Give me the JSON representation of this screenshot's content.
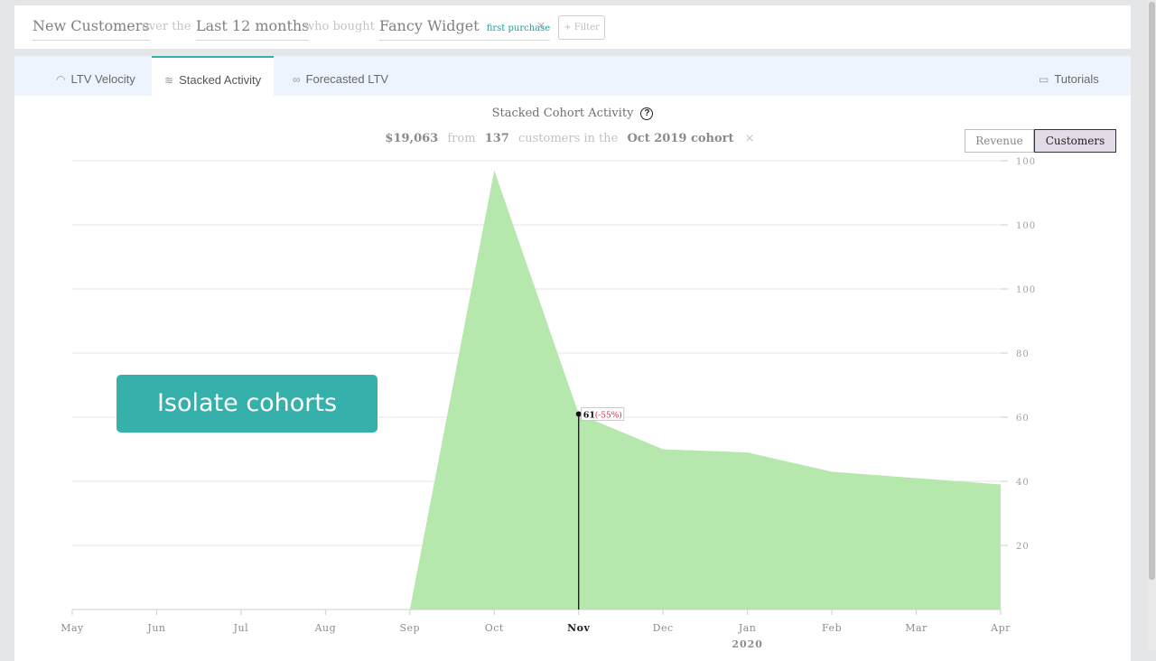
{
  "filter_bar": {
    "segment": "New Customers",
    "over_text": "over the",
    "period": "Last 12 months",
    "bought_text": "who bought",
    "product": "Fancy Widget",
    "qualifier": "first purchase",
    "remove_symbol": "×",
    "filter_button": "+ Filter"
  },
  "tabs": [
    {
      "label": "LTV Velocity",
      "icon": "speedometer-icon"
    },
    {
      "label": "Stacked Activity",
      "icon": "layers-icon",
      "active": true
    },
    {
      "label": "Forecasted LTV",
      "icon": "binoculars-icon"
    }
  ],
  "tutorials_label": "Tutorials",
  "chart_header": {
    "title": "Stacked Cohort Activity",
    "help_glyph": "?",
    "amount": "$19,063",
    "from_text": "from",
    "count": "137",
    "customers_text": "customers in the",
    "cohort": "Oct 2019 cohort",
    "close_symbol": "×"
  },
  "toggle": {
    "revenue": "Revenue",
    "customers": "Customers",
    "selected": "Customers"
  },
  "overlay_label": "Isolate cohorts",
  "colors": {
    "area_fill": "#b6e8ae",
    "accent": "#34b1a8",
    "tooltip_pct": "#d23050"
  },
  "chart_data": {
    "type": "area",
    "categories": [
      "May",
      "Jun",
      "Jul",
      "Aug",
      "Sep",
      "Oct",
      "Nov",
      "Dec",
      "Jan",
      "Feb",
      "Mar",
      "Apr"
    ],
    "year_label": "2020",
    "values": [
      0,
      0,
      0,
      0,
      0,
      137,
      61,
      50,
      49,
      43,
      41,
      39
    ],
    "y_tick_labels": [
      "100",
      "100",
      "100",
      "80",
      "60",
      "40",
      "20"
    ],
    "y_tick_values": [
      140,
      120,
      100,
      80,
      60,
      40,
      20
    ],
    "ylim": [
      0,
      140
    ],
    "grid": true,
    "highlight": {
      "category": "Nov",
      "value_label": "61",
      "change_label": "(-55%)"
    }
  }
}
